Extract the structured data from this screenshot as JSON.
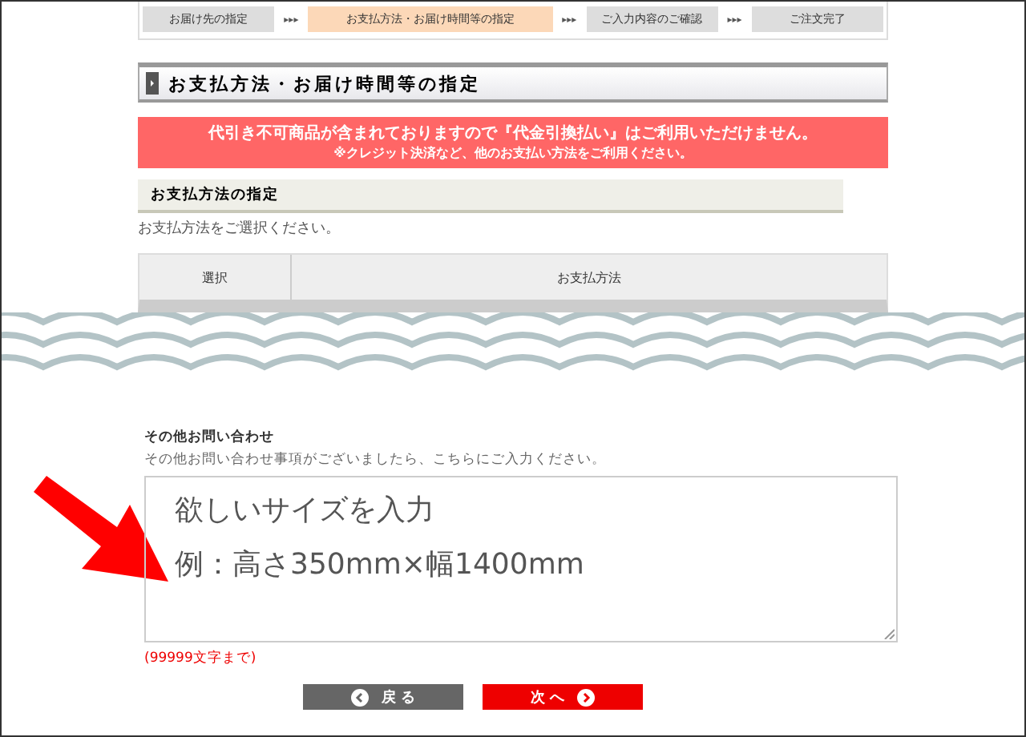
{
  "steps": [
    {
      "label": "お届け先の指定",
      "selected": false
    },
    {
      "label": "お支払方法・お届け時間等の指定",
      "selected": true
    },
    {
      "label": "ご入力内容のご確認",
      "selected": false
    },
    {
      "label": "ご注文完了",
      "selected": false
    }
  ],
  "step_separator": "▸▸▸",
  "page_heading": "お支払方法・お届け時間等の指定",
  "alert": {
    "message": "代引き不可商品が含まれておりますので『代金引換払い』はご利用いただけません。",
    "note": "※クレジット決済など、他のお支払い方法をご利用ください。"
  },
  "payment_section": {
    "heading": "お支払方法の指定",
    "instruction": "お支払方法をご選択ください。",
    "table": {
      "columns": [
        "選択",
        "お支払方法"
      ]
    }
  },
  "inquiry": {
    "label": "その他お問い合わせ",
    "description": "その他お問い合わせ事項がございましたら、こちらにご入力ください。",
    "value_lines": [
      "欲しいサイズを入力",
      "例：高さ350mm×幅1400mm"
    ],
    "limit_note": "(99999文字まで)"
  },
  "buttons": [
    {
      "label": "戻 る",
      "kind": "back"
    },
    {
      "label": "次 へ",
      "kind": "next"
    }
  ]
}
